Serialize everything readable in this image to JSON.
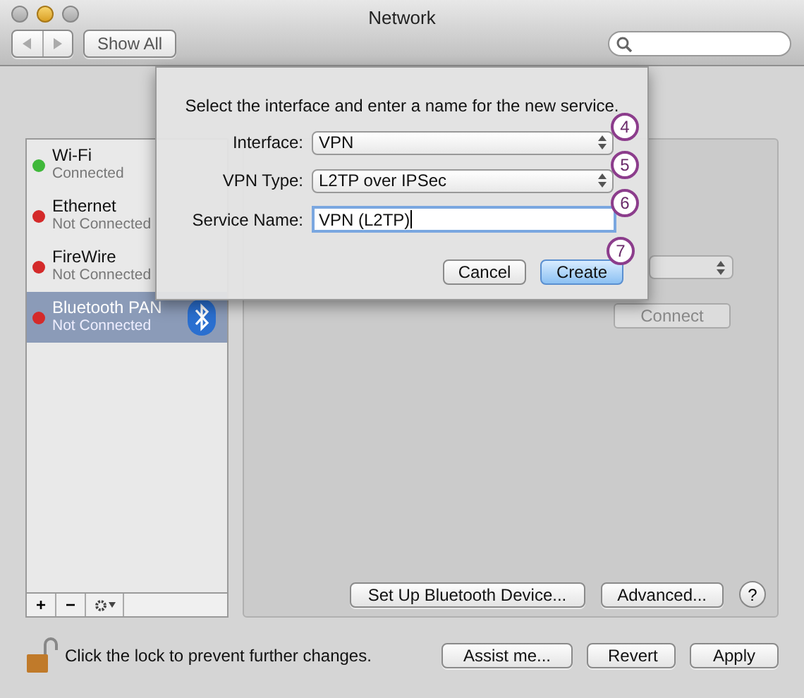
{
  "window": {
    "title": "Network"
  },
  "toolbar": {
    "show_all": "Show All"
  },
  "sidebar": {
    "items": [
      {
        "name": "Wi-Fi",
        "status": "Connected",
        "color": "#3fb83a",
        "selected": false
      },
      {
        "name": "Ethernet",
        "status": "Not Connected",
        "color": "#d42a2a",
        "selected": false
      },
      {
        "name": "FireWire",
        "status": "Not Connected",
        "color": "#d42a2a",
        "selected": false
      },
      {
        "name": "Bluetooth PAN",
        "status": "Not Connected",
        "color": "#d42a2a",
        "selected": true
      }
    ],
    "add": "+",
    "remove": "−"
  },
  "pane": {
    "connect": "Connect",
    "setup": "Set Up Bluetooth Device...",
    "advanced": "Advanced...",
    "help": "?"
  },
  "sheet": {
    "instruction": "Select the interface and enter a name for the new service.",
    "fields": [
      {
        "kind": "popup",
        "label": "Interface:",
        "value": "VPN",
        "callout": "4"
      },
      {
        "kind": "popup",
        "label": "VPN Type:",
        "value": "L2TP over IPSec",
        "callout": "5"
      },
      {
        "kind": "text",
        "label": "Service Name:",
        "value": "VPN (L2TP)",
        "callout": "6"
      }
    ],
    "buttons": [
      {
        "label": "Cancel",
        "default": false
      },
      {
        "label": "Create",
        "default": true,
        "callout": "7"
      }
    ]
  },
  "footer": {
    "lock_text": "Click the lock to prevent further changes.",
    "buttons": [
      "Assist me...",
      "Revert",
      "Apply"
    ]
  }
}
